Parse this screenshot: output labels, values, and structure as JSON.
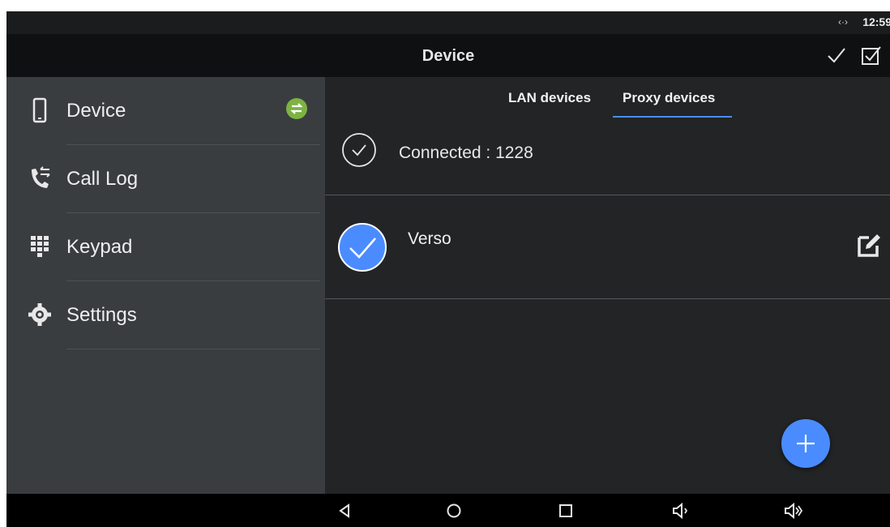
{
  "status_bar": {
    "network_icon": "network-activity-icon",
    "time": "12:59"
  },
  "app_bar": {
    "title": "Device",
    "actions": [
      {
        "name": "confirm",
        "icon": "check-icon"
      },
      {
        "name": "select-all",
        "icon": "checkbox-checked-icon"
      }
    ]
  },
  "sidebar": {
    "items": [
      {
        "label": "Device",
        "icon": "phone-device-icon",
        "badge": "sync-icon",
        "badge_color": "#7cb342"
      },
      {
        "label": "Call Log",
        "icon": "call-log-icon"
      },
      {
        "label": "Keypad",
        "icon": "keypad-icon"
      },
      {
        "label": "Settings",
        "icon": "gear-icon"
      }
    ]
  },
  "tabs": [
    {
      "label": "LAN devices",
      "active": false
    },
    {
      "label": "Proxy devices",
      "active": true
    }
  ],
  "connection": {
    "text": "Connected : 1228",
    "icon": "check-circle-outline-icon"
  },
  "devices": [
    {
      "name": "Verso",
      "checked": true,
      "edit_icon": "edit-icon"
    }
  ],
  "fab": {
    "icon": "plus-icon"
  },
  "nav_bar": {
    "buttons": [
      "back-icon",
      "home-icon",
      "recents-icon",
      "volume-down-icon",
      "volume-up-icon"
    ]
  },
  "colors": {
    "accent": "#4a8cff",
    "sync_badge": "#7cb342",
    "sidebar_bg": "#3a3d40",
    "content_bg": "#222426"
  }
}
